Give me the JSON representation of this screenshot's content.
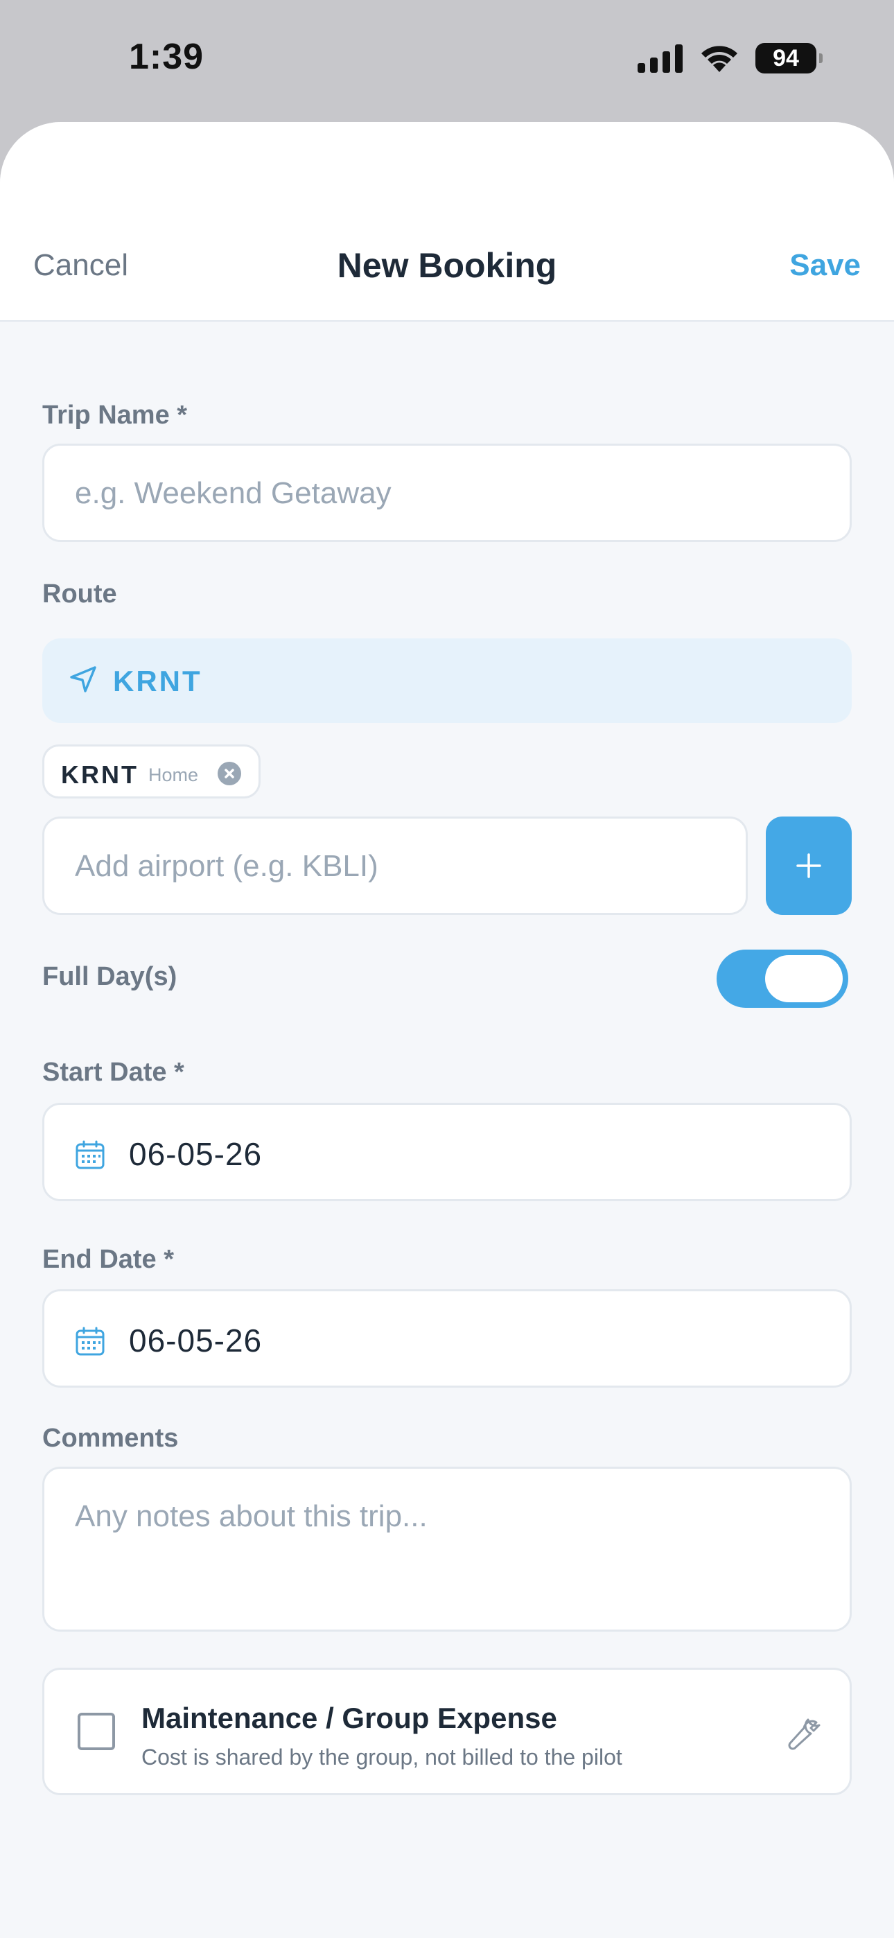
{
  "status_bar": {
    "time": "1:39",
    "battery": "94"
  },
  "header": {
    "cancel": "Cancel",
    "title": "New Booking",
    "save": "Save"
  },
  "trip_name": {
    "label": "Trip Name *",
    "placeholder": "e.g. Weekend Getaway"
  },
  "route": {
    "label": "Route",
    "summary": "KRNT",
    "chips": [
      {
        "code": "KRNT",
        "tag": "Home"
      }
    ],
    "add_placeholder": "Add airport (e.g. KBLI)"
  },
  "full_day": {
    "label": "Full Day(s)",
    "enabled": true
  },
  "start_date": {
    "label": "Start Date *",
    "value": "06-05-26"
  },
  "end_date": {
    "label": "End Date *",
    "value": "06-05-26"
  },
  "comments": {
    "label": "Comments",
    "placeholder": "Any notes about this trip..."
  },
  "maintenance": {
    "title": "Maintenance / Group Expense",
    "subtitle": "Cost is shared by the group, not billed to the pilot",
    "checked": false
  },
  "colors": {
    "accent": "#44a8e6",
    "accent_light": "#e6f2fb",
    "text": "#1e2a38",
    "muted": "#6b7785"
  }
}
